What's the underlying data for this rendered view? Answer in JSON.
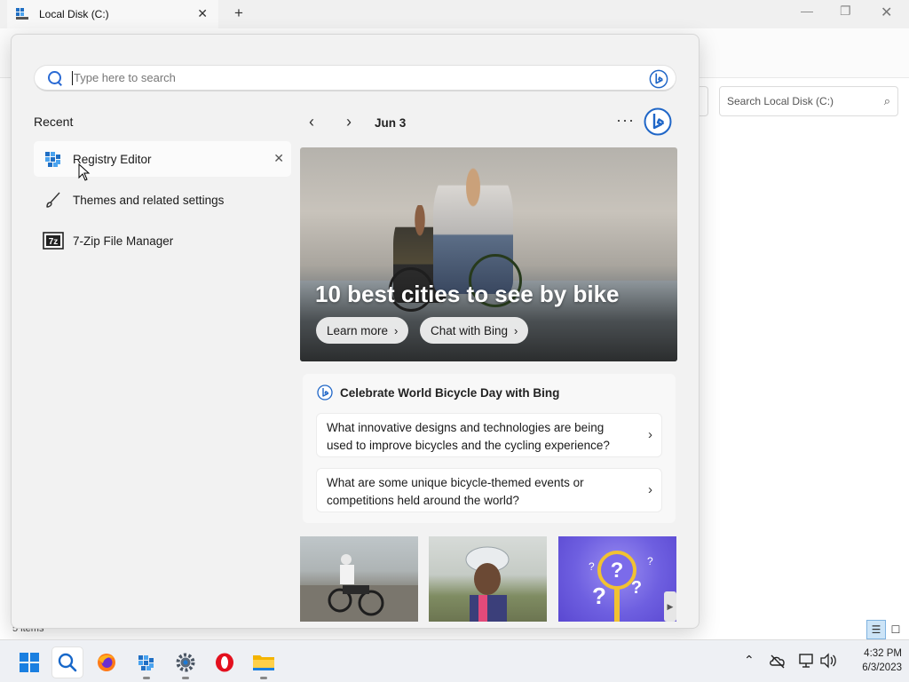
{
  "explorer": {
    "tab_title": "Local Disk (C:)",
    "search_placeholder": "Search Local Disk (C:)",
    "status": "5 items"
  },
  "search": {
    "placeholder": "Type here to search"
  },
  "recent": {
    "title": "Recent",
    "items": [
      {
        "label": "Registry Editor"
      },
      {
        "label": "Themes and related settings"
      },
      {
        "label": "7-Zip File Manager"
      }
    ]
  },
  "feed": {
    "date": "Jun 3",
    "more": "···",
    "hero": {
      "title": "10 best cities to see by bike",
      "learn_more": "Learn more",
      "chat": "Chat with Bing"
    },
    "bing_card": {
      "title": "Celebrate World Bicycle Day with Bing",
      "questions": [
        "What innovative designs and technologies are being used to improve bicycles and the cycling experience?",
        "What are some unique bicycle-themed events or competitions held around the world?"
      ]
    }
  },
  "taskbar": {
    "time": "4:32 PM",
    "date": "6/3/2023"
  },
  "colors": {
    "accent": "#2a6ad4",
    "bing_blue": "#1f66c7"
  }
}
